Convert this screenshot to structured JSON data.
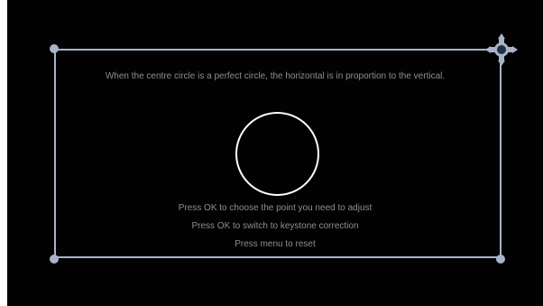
{
  "screen": {
    "top_text": "When the centre circle is a perfect circle, the horizontal is in proportion to the vertical.",
    "instructions": [
      "Press OK to choose the point you need to adjust",
      "Press OK to switch to keystone correction",
      "Press menu to reset"
    ]
  },
  "colors": {
    "background": "#020202",
    "frame": "#a8b3c7",
    "circle": "#ffffff",
    "text": "#8e8e8e"
  },
  "icons": {
    "active_corner": "four-way-arrow-cursor-icon"
  }
}
